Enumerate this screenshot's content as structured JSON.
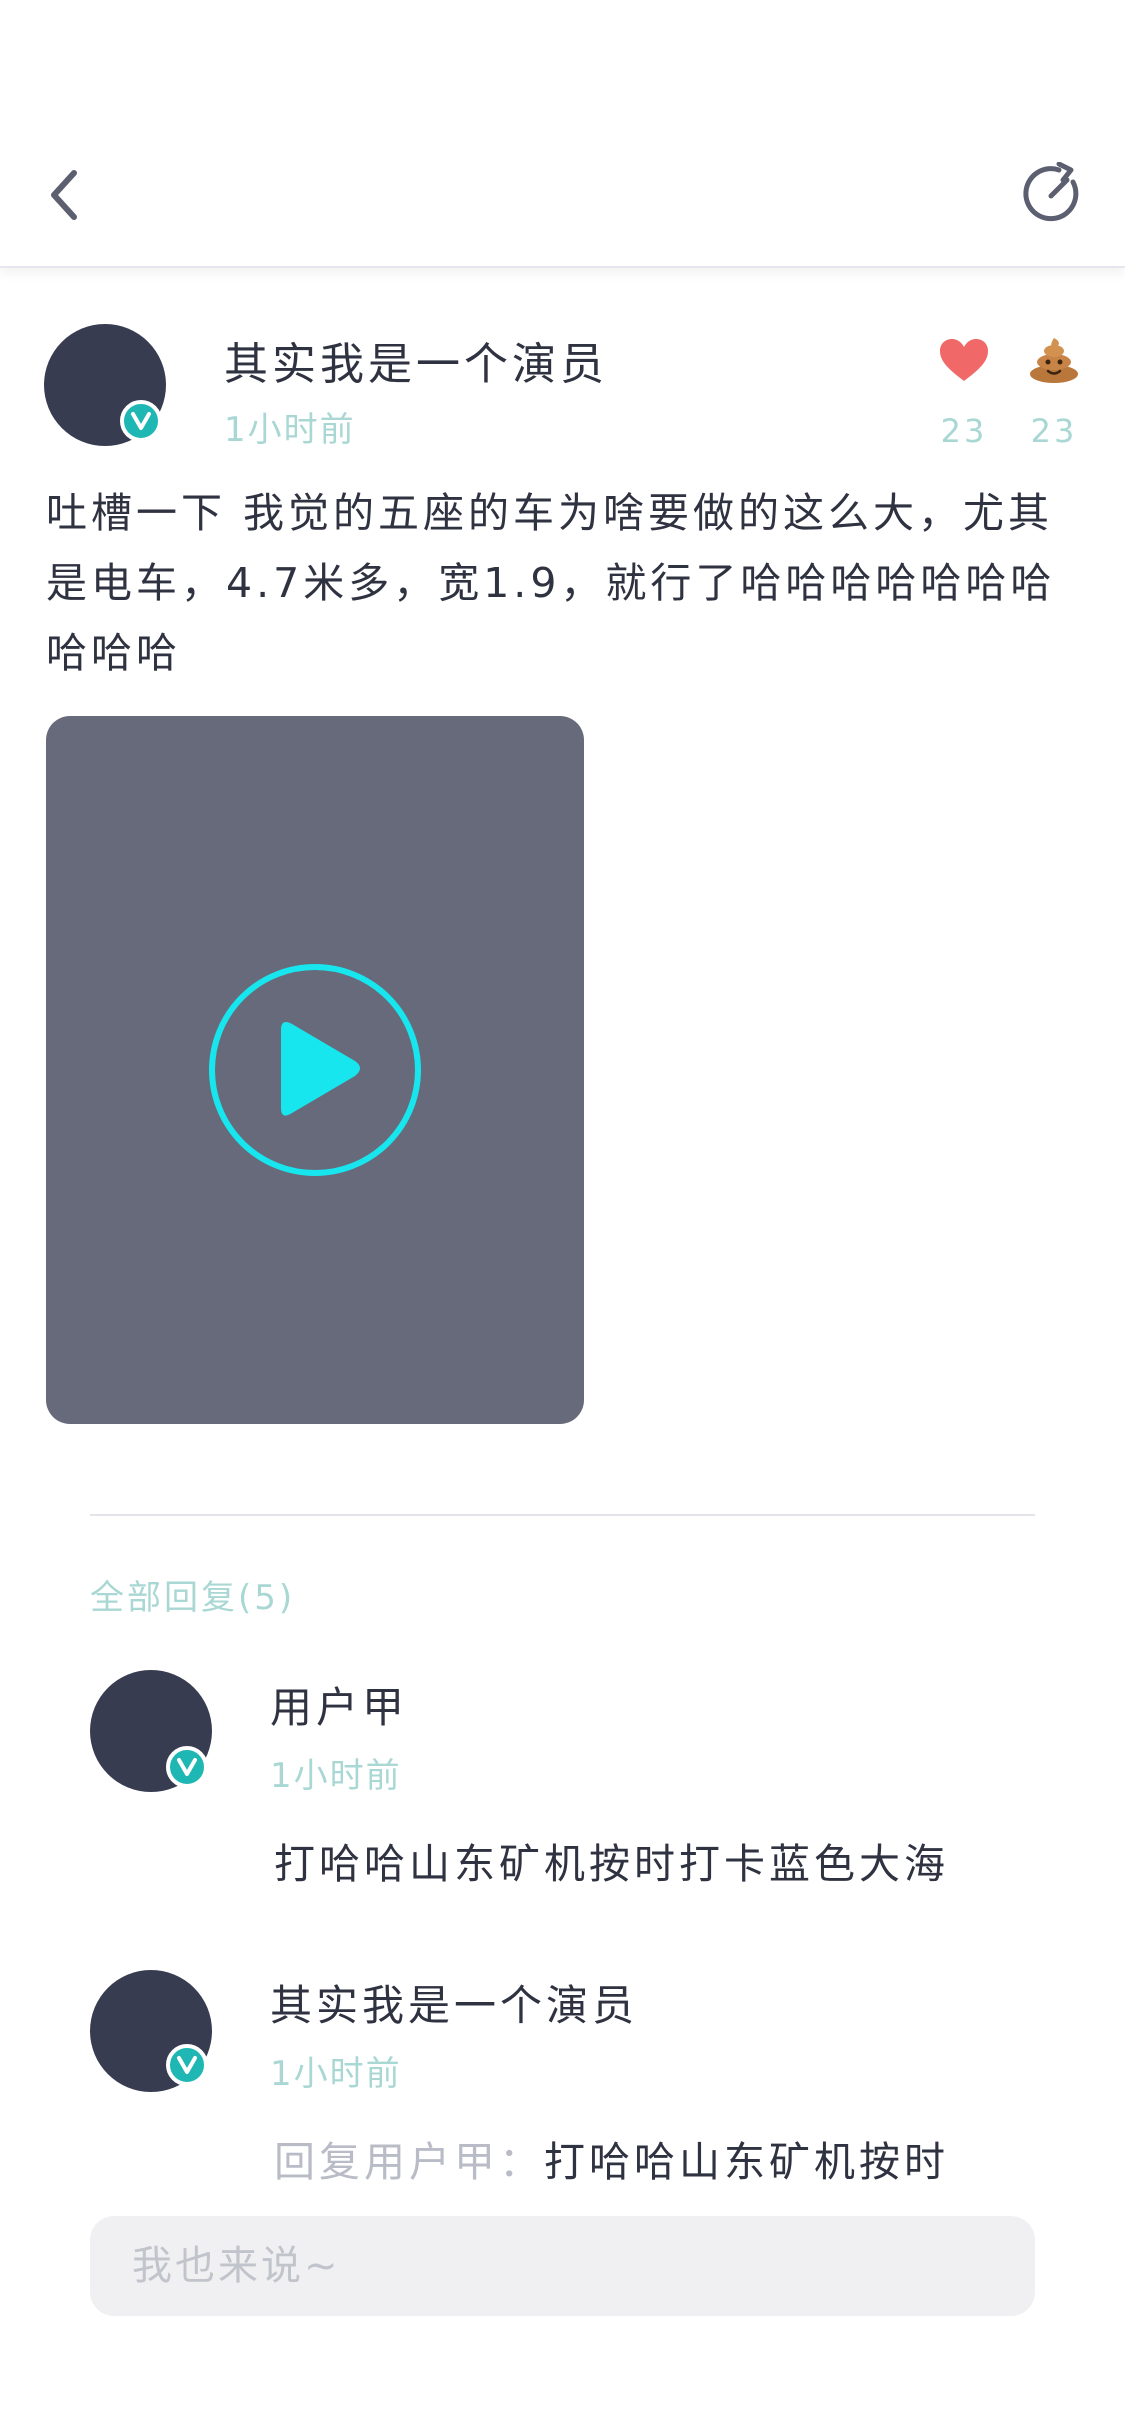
{
  "post": {
    "author": "其实我是一个演员",
    "time": "1小时前",
    "likes": "23",
    "poops": "23",
    "text": "吐槽一下 我觉的五座的车为啥要做的这么大，尤其是电车，4.7米多，宽1.9，就行了哈哈哈哈哈哈哈哈哈哈"
  },
  "replies": {
    "title": "全部回复(5)",
    "items": [
      {
        "name": "用户甲",
        "time": "1小时前",
        "prefix": "",
        "text": "打哈哈山东矿机按时打卡蓝色大海"
      },
      {
        "name": "其实我是一个演员",
        "time": "1小时前",
        "prefix": "回复用户甲：",
        "text": "打哈哈山东矿机按时"
      }
    ]
  },
  "comment_input": {
    "placeholder": "我也来说~"
  },
  "colors": {
    "accent": "#1fb7b3",
    "play": "#18e6ee",
    "like": "#f06868",
    "subtle_text": "#a9d7d3"
  },
  "icons": [
    "back-icon",
    "refresh-icon",
    "heart-icon",
    "poop-icon",
    "play-icon",
    "verified-icon"
  ]
}
